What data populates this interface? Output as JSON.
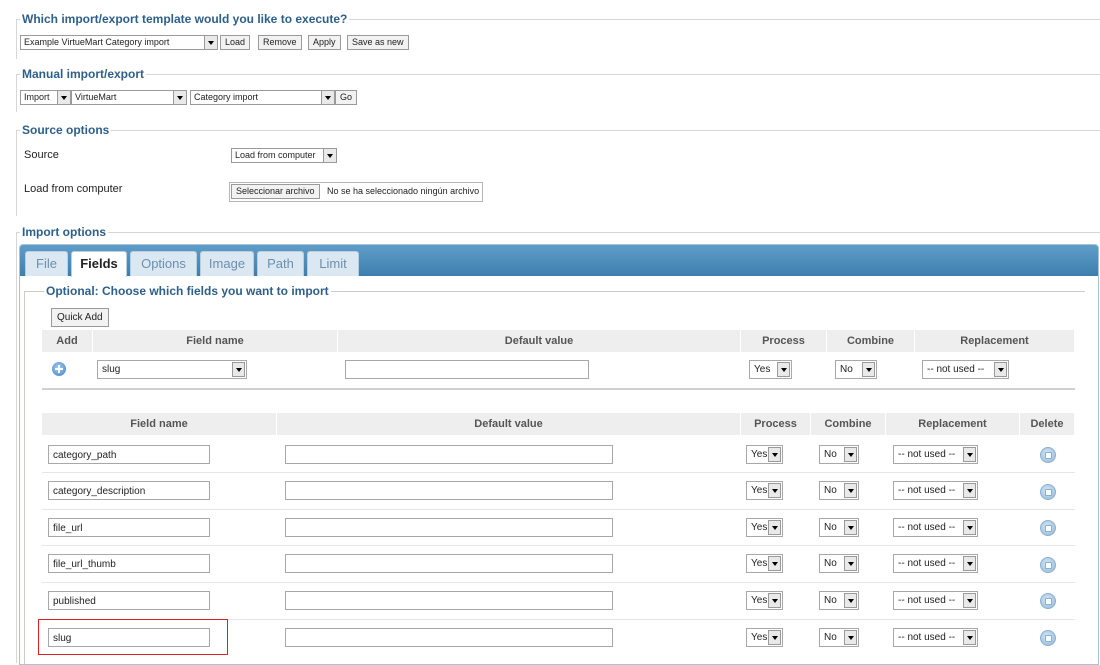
{
  "template_section": {
    "legend": "Which import/export template would you like to execute?",
    "selected": "Example VirtueMart Category import",
    "buttons": {
      "load": "Load",
      "remove": "Remove",
      "apply": "Apply",
      "save_new": "Save as new"
    }
  },
  "manual_section": {
    "legend": "Manual import/export",
    "action": "Import",
    "component": "VirtueMart",
    "operation": "Category import",
    "go": "Go"
  },
  "source_section": {
    "legend": "Source options",
    "source_label": "Source",
    "source_value": "Load from computer",
    "load_label": "Load from computer",
    "file_button": "Seleccionar archivo",
    "file_status": "No se ha seleccionado ningún archivo"
  },
  "import_options": {
    "legend": "Import options",
    "tabs": [
      "File",
      "Fields",
      "Options",
      "Image",
      "Path",
      "Limit"
    ],
    "active_tab": "Fields",
    "subsection_legend": "Optional: Choose which fields you want to import",
    "quick_add": "Quick Add",
    "add_headers": {
      "add": "Add",
      "field_name": "Field name",
      "default_value": "Default value",
      "process": "Process",
      "combine": "Combine",
      "replacement": "Replacement"
    },
    "add_row": {
      "field": "slug",
      "default": "",
      "process": "Yes",
      "combine": "No",
      "replacement": "-- not used --"
    },
    "list_headers": {
      "field_name": "Field name",
      "default_value": "Default value",
      "process": "Process",
      "combine": "Combine",
      "replacement": "Replacement",
      "delete": "Delete"
    },
    "rows": [
      {
        "field": "category_path",
        "default": "",
        "process": "Yes",
        "combine": "No",
        "replacement": "-- not used --"
      },
      {
        "field": "category_description",
        "default": "",
        "process": "Yes",
        "combine": "No",
        "replacement": "-- not used --"
      },
      {
        "field": "file_url",
        "default": "",
        "process": "Yes",
        "combine": "No",
        "replacement": "-- not used --"
      },
      {
        "field": "file_url_thumb",
        "default": "",
        "process": "Yes",
        "combine": "No",
        "replacement": "-- not used --"
      },
      {
        "field": "published",
        "default": "",
        "process": "Yes",
        "combine": "No",
        "replacement": "-- not used --"
      },
      {
        "field": "slug",
        "default": "",
        "process": "Yes",
        "combine": "No",
        "replacement": "-- not used --"
      }
    ]
  },
  "colors": {
    "legend": "#2e5f8a",
    "tabbar": "#3e7eae",
    "highlight": "#e02020"
  }
}
